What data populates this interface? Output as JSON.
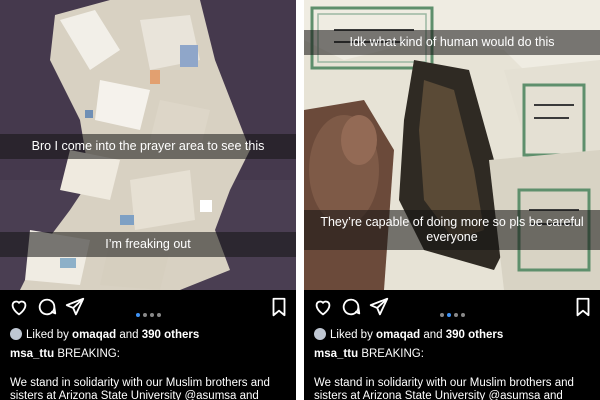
{
  "posts": [
    {
      "captions": [
        "Bro I come into the prayer area to see this",
        "I’m freaking out"
      ],
      "carousel": {
        "count": 4,
        "active_index": 0
      },
      "likes": {
        "prefix": "Liked by",
        "user": "omaqad",
        "joiner": "and",
        "others": "390 others"
      },
      "username": "msa_ttu",
      "headline": "BREAKING:",
      "body": "We stand in solidarity with our Muslim brothers and sisters at Arizona State University @asumsa and"
    },
    {
      "captions": [
        "Idk what kind of human would do this",
        "They’re capable of doing more so pls be careful everyone"
      ],
      "carousel": {
        "count": 4,
        "active_index": 1
      },
      "likes": {
        "prefix": "Liked by",
        "user": "omaqad",
        "joiner": "and",
        "others": "390 others"
      },
      "username": "msa_ttu",
      "headline": "BREAKING:",
      "body": "We stand in solidarity with our Muslim brothers and sisters at Arizona State University @asumsa and"
    }
  ],
  "icons": [
    "heart-icon",
    "comment-icon",
    "share-icon",
    "bookmark-icon"
  ],
  "colors": {
    "background": "#000000",
    "text": "#ffffff",
    "active_dot": "#3f93f5",
    "inactive_dot": "#888888"
  }
}
